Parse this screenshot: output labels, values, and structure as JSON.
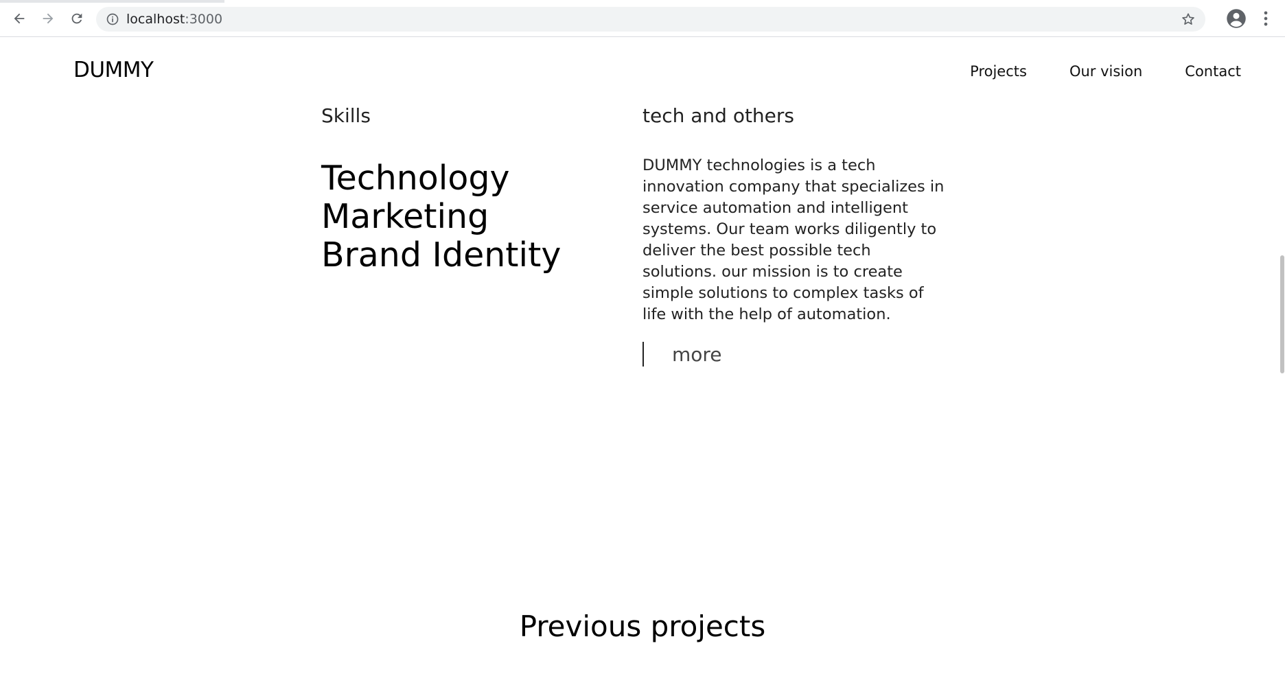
{
  "browser": {
    "url_host": "localhost",
    "url_port": ":3000",
    "icons": {
      "back": "back-arrow-icon",
      "forward": "forward-arrow-icon",
      "reload": "reload-icon",
      "info": "info-icon",
      "bookmark": "star-icon",
      "profile": "profile-icon",
      "menu": "kebab-menu-icon"
    }
  },
  "header": {
    "logo": "DUMMY",
    "nav": [
      "Projects",
      "Our vision",
      "Contact"
    ]
  },
  "skills": {
    "heading": "Skills",
    "items": [
      "Technology",
      "Marketing",
      "Brand Identity"
    ]
  },
  "about": {
    "title": "tech and others",
    "description": "DUMMY technologies is a tech innovation company that specializes in service automation and intelligent systems. Our team works diligently to deliver the best possible tech solutions. our mission is to create simple solutions to complex tasks of life with the help of automation.",
    "more_label": "more"
  },
  "projects": {
    "heading": "Previous projects"
  },
  "colors": {
    "text": "#111111",
    "omnibox_bg": "#f1f3f4",
    "scroll_thumb": "#c1c1c1"
  }
}
